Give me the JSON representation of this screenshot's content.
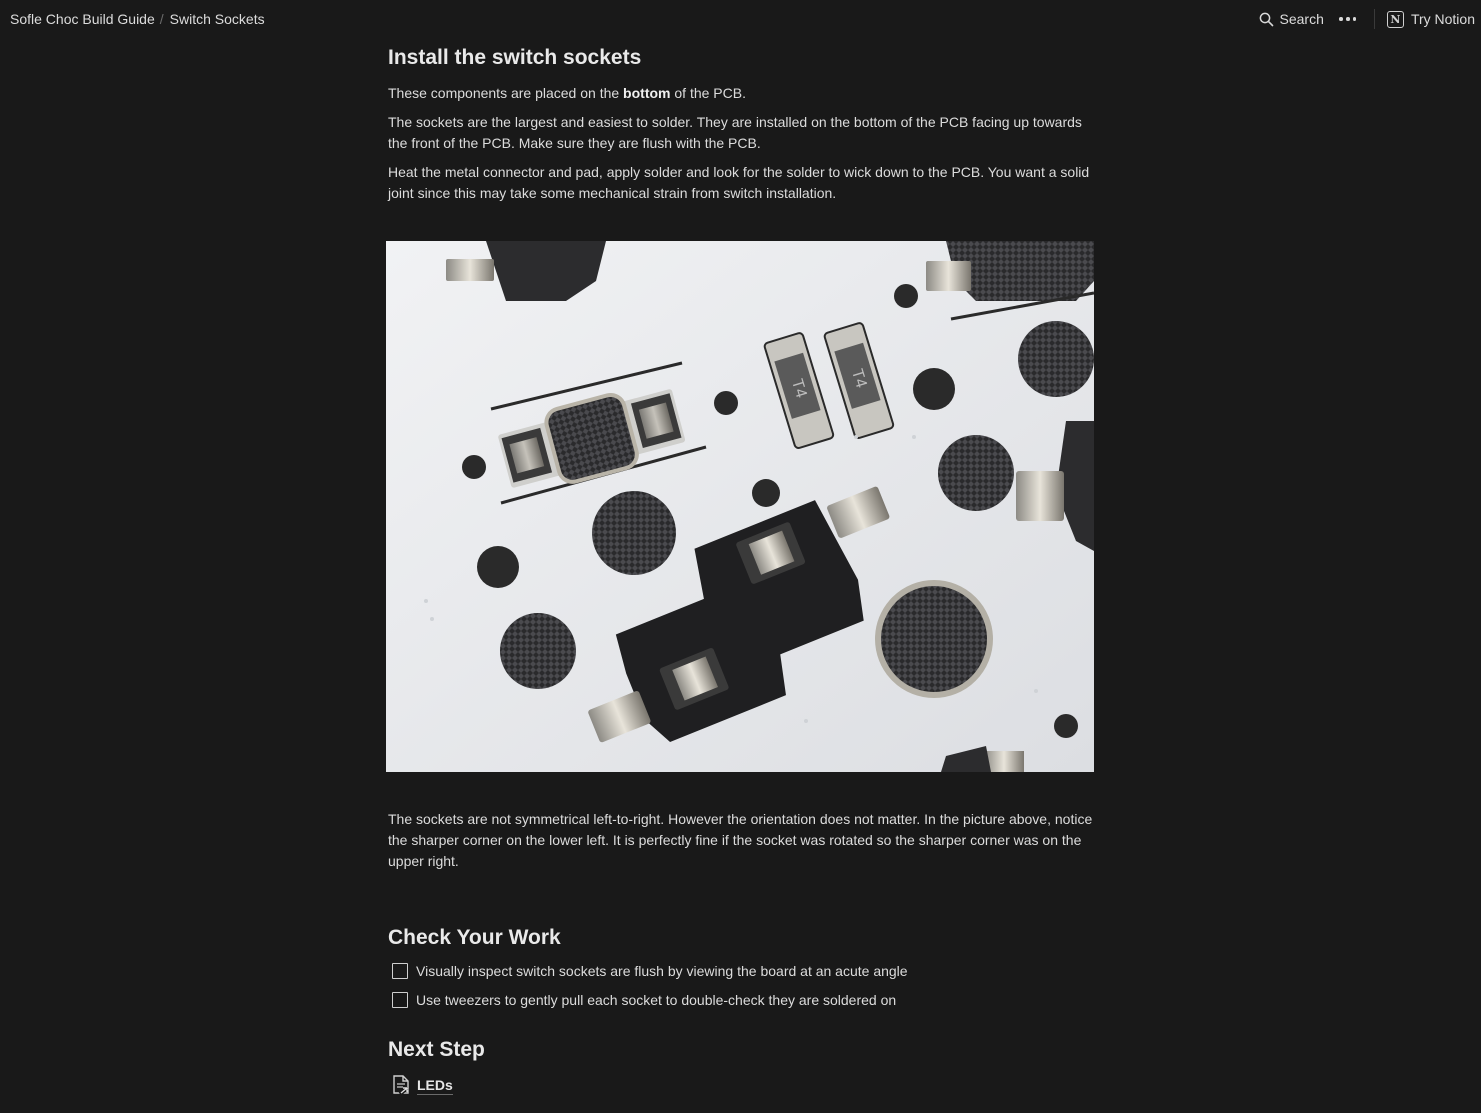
{
  "breadcrumb": {
    "items": [
      "Sofle Choc Build Guide",
      "Switch Sockets"
    ],
    "separator": "/"
  },
  "topbar": {
    "search_label": "Search",
    "try_notion_label": "Try Notion",
    "icons": [
      "search-icon",
      "more-icon",
      "notion-logo-icon"
    ]
  },
  "section1": {
    "heading": "Install the switch sockets",
    "p1_before": "These components are placed on the ",
    "p1_bold": "bottom",
    "p1_after": " of the PCB.",
    "p2": "The sockets are the largest and easiest to solder. They are installed on the bottom of the PCB facing up towards the front of the PCB. Make sure they are flush with the PCB.",
    "p3": "Heat the metal connector and pad, apply solder and look for the solder to wick down to the PCB. You want a solid joint since this may take some mechanical strain from switch installation.",
    "p4": "The sockets are not symmetrical left-to-right. However the orientation does not matter. In the picture above, notice the sharper corner on the lower left. It is perfectly fine if the socket was rotated so the sharper corner was on the upper right."
  },
  "check_your_work": {
    "heading": "Check Your Work",
    "items": [
      {
        "label": "Visually inspect switch sockets are flush by viewing the board at an acute angle",
        "checked": false
      },
      {
        "label": "Use tweezers to gently pull each socket to double-check they are soldered on",
        "checked": false
      }
    ]
  },
  "next_step": {
    "heading": "Next Step",
    "link_label": "LEDs",
    "link_icon": "page-link-icon"
  },
  "photo": {
    "component_marking": "T4"
  },
  "colors": {
    "background": "#191919",
    "text": "#e6e6e6"
  }
}
